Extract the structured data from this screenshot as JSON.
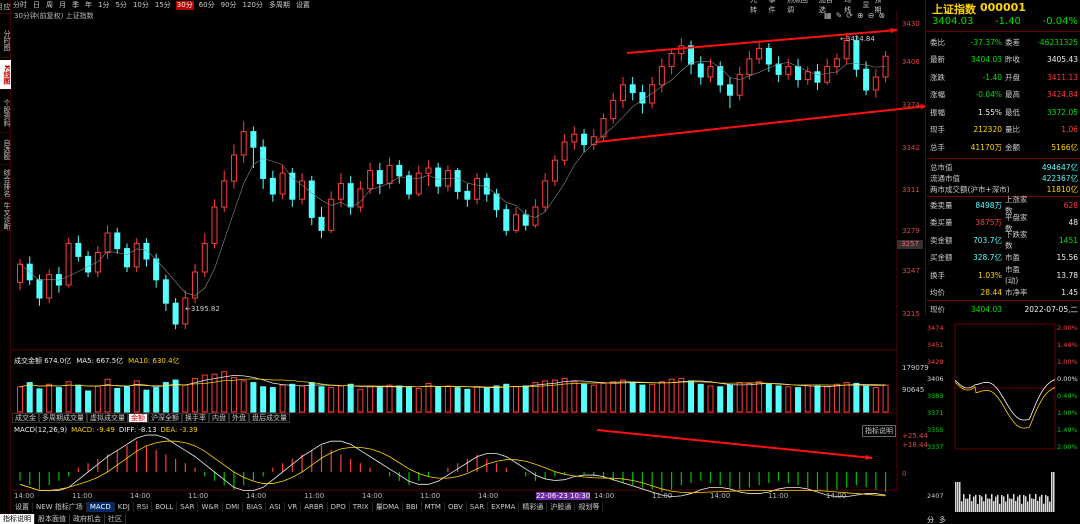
{
  "sidebar": {
    "items": [
      "应用",
      "分时图",
      "K线图",
      "个股资料",
      "自选股",
      "综合排名",
      "牛叉诊断"
    ]
  },
  "periods": [
    "分时",
    "日",
    "周",
    "月",
    "季",
    "年",
    "1分",
    "5分",
    "10分",
    "15分",
    "30分",
    "60分",
    "90分",
    "120分",
    "多周期",
    "设置"
  ],
  "active_period": "30分",
  "toolbar": [
    "九转",
    "事件",
    "热点回调",
    "加自选",
    "均线",
    "显",
    "预期"
  ],
  "chart_title": "30分钟(前复权) 上证指数",
  "price_axis": [
    "3430",
    "3406",
    "3374",
    "3342",
    "3311",
    "3279",
    "3257",
    "3247",
    "3215"
  ],
  "price_current_label": "3257",
  "annot_high": "3424.84",
  "annot_low": "3195.82",
  "volume_header": {
    "label": "成交金额 674.0亿",
    "ma5": "MA5: 667.5亿",
    "ma10": "MA10: 630.4亿"
  },
  "volume_axis": [
    "179079",
    "90645"
  ],
  "sub_tabs": [
    "成交金",
    "多周期成交量",
    "虚拟成交量",
    "金额",
    "沪深全额",
    "换手率",
    "内盘",
    "外盘",
    "盘后成交量"
  ],
  "active_sub_tab": "金额",
  "macd_header": {
    "label": "MACD(12,26,9)",
    "macd": "MACD: -9.49",
    "diff": "DIFF: -8.13",
    "dea": "DEA: -3.39"
  },
  "macd_axis": [
    "+25.44",
    "+18.44",
    "0"
  ],
  "macd_button": "指标说明",
  "time_axis": [
    "14:00",
    "11:00",
    "14:00",
    "11:00",
    "14:00",
    "11:00",
    "14:00",
    "11:00",
    "14:00",
    "22-06-23 10:30",
    "14:00",
    "11:00",
    "14:00",
    "11:00",
    "14:00"
  ],
  "bottom_tabs": [
    "设置",
    "NEW 指标广场",
    "MACD",
    "KDJ",
    "RSI",
    "BOLL",
    "SAR",
    "W&R",
    "DMI",
    "BIAS",
    "ASI",
    "VR",
    "ARBR",
    "DPO",
    "TRIX",
    "量DMA",
    "BBI",
    "MTM",
    "OBV",
    "SAR",
    "EXPMA",
    "精彩通",
    "沪股通",
    "规划等"
  ],
  "active_bottom_tab": "MACD",
  "status_tabs": [
    "指标说明",
    "股本面值",
    "政府机会",
    "社区"
  ],
  "active_status_tab": "指标说明",
  "quote": {
    "name": "上证指数",
    "code": "000001",
    "price": "3404.03",
    "change": "-1.40",
    "change_pct": "-0.04%",
    "rows": [
      {
        "l1": "委比",
        "v1": "-37.37%",
        "c1": "green",
        "l2": "委差",
        "v2": "-46231325",
        "c2": "green"
      },
      {
        "l1": "最新",
        "v1": "3404.03",
        "c1": "green",
        "l2": "昨收",
        "v2": "3405.43",
        "c2": "white"
      },
      {
        "l1": "涨跌",
        "v1": "-1.40",
        "c1": "green",
        "l2": "开盘",
        "v2": "3411.13",
        "c2": "red"
      },
      {
        "l1": "涨幅",
        "v1": "-0.04%",
        "c1": "green",
        "l2": "最高",
        "v2": "3424.84",
        "c2": "red"
      },
      {
        "l1": "振幅",
        "v1": "1.55%",
        "c1": "white",
        "l2": "最低",
        "v2": "3372.05",
        "c2": "green"
      },
      {
        "l1": "现手",
        "v1": "212320",
        "c1": "yellow",
        "l2": "量比",
        "v2": "1.06",
        "c2": "red"
      },
      {
        "l1": "总手",
        "v1": "41170万",
        "c1": "yellow",
        "l2": "金额",
        "v2": "5166亿",
        "c2": "yellow"
      }
    ],
    "cap": [
      {
        "l": "总市值",
        "v": "494647亿",
        "c": "cyan"
      },
      {
        "l": "流通市值",
        "v": "422367亿",
        "c": "cyan"
      },
      {
        "l": "两市成交额(沪市+深市)",
        "v": "11810亿",
        "c": "yellow"
      }
    ],
    "rows2": [
      {
        "l1": "委卖量",
        "v1": "8498万",
        "c1": "cyan",
        "l2": "上涨家数",
        "v2": "628",
        "c2": "red"
      },
      {
        "l1": "委买量",
        "v1": "3875万",
        "c1": "red",
        "l2": "平盘家数",
        "v2": "48",
        "c2": "white"
      },
      {
        "l1": "卖金额",
        "v1": "703.7亿",
        "c1": "cyan",
        "l2": "下跌家数",
        "v2": "1451",
        "c2": "green"
      },
      {
        "l1": "买金额",
        "v1": "328.7亿",
        "c1": "cyan",
        "l2": "市盈",
        "v2": "15.56",
        "c2": "white"
      },
      {
        "l1": "换手",
        "v1": "1.03%",
        "c1": "yellow",
        "l2": "市盈(动)",
        "v2": "13.78",
        "c2": "white"
      },
      {
        "l1": "均价",
        "v1": "28.44",
        "c1": "yellow",
        "l2": "市净率",
        "v2": "1.45",
        "c2": "white"
      }
    ],
    "now_label": "现价",
    "now_value": "3404.03",
    "date": "2022-07-05,二"
  },
  "mini_axis_left": [
    "3474",
    "3451",
    "3429",
    "3406",
    "3383",
    "3371",
    "3355",
    "3337"
  ],
  "mini_axis_right": [
    "2.00%",
    "1.49%",
    "1.00%",
    "0.00%",
    "0.49%",
    "1.00%",
    "1.49%",
    "2.00%"
  ],
  "mini_vol_axis": [
    "2407"
  ],
  "mini_bottom": [
    "分",
    "多"
  ],
  "chart_data": {
    "type": "candlestick",
    "price_range": [
      3180,
      3440
    ],
    "candles": [
      [
        3232,
        3246,
        3226,
        3250
      ],
      [
        3246,
        3234,
        3230,
        3252
      ],
      [
        3234,
        3220,
        3214,
        3238
      ],
      [
        3220,
        3238,
        3216,
        3242
      ],
      [
        3238,
        3230,
        3224,
        3244
      ],
      [
        3230,
        3262,
        3228,
        3266
      ],
      [
        3262,
        3252,
        3248,
        3268
      ],
      [
        3252,
        3240,
        3236,
        3256
      ],
      [
        3240,
        3255,
        3236,
        3260
      ],
      [
        3255,
        3270,
        3250,
        3276
      ],
      [
        3270,
        3258,
        3254,
        3274
      ],
      [
        3258,
        3244,
        3240,
        3262
      ],
      [
        3244,
        3262,
        3240,
        3266
      ],
      [
        3262,
        3250,
        3244,
        3266
      ],
      [
        3250,
        3234,
        3228,
        3254
      ],
      [
        3234,
        3216,
        3210,
        3238
      ],
      [
        3216,
        3200,
        3196,
        3220
      ],
      [
        3200,
        3220,
        3196,
        3226
      ],
      [
        3220,
        3240,
        3216,
        3246
      ],
      [
        3240,
        3262,
        3236,
        3270
      ],
      [
        3262,
        3290,
        3258,
        3296
      ],
      [
        3290,
        3310,
        3286,
        3318
      ],
      [
        3310,
        3330,
        3304,
        3338
      ],
      [
        3330,
        3348,
        3324,
        3356
      ],
      [
        3348,
        3336,
        3320,
        3352
      ],
      [
        3336,
        3312,
        3304,
        3342
      ],
      [
        3312,
        3300,
        3294,
        3318
      ],
      [
        3300,
        3316,
        3296,
        3322
      ],
      [
        3316,
        3296,
        3290,
        3320
      ],
      [
        3296,
        3310,
        3292,
        3316
      ],
      [
        3310,
        3282,
        3276,
        3314
      ],
      [
        3282,
        3272,
        3266,
        3290
      ],
      [
        3272,
        3296,
        3270,
        3302
      ],
      [
        3296,
        3308,
        3290,
        3316
      ],
      [
        3308,
        3290,
        3284,
        3314
      ],
      [
        3290,
        3304,
        3286,
        3310
      ],
      [
        3304,
        3318,
        3300,
        3324
      ],
      [
        3318,
        3308,
        3300,
        3324
      ],
      [
        3308,
        3322,
        3304,
        3328
      ],
      [
        3322,
        3314,
        3308,
        3326
      ],
      [
        3314,
        3300,
        3296,
        3318
      ],
      [
        3300,
        3316,
        3298,
        3322
      ],
      [
        3316,
        3320,
        3306,
        3326
      ],
      [
        3320,
        3306,
        3300,
        3324
      ],
      [
        3306,
        3318,
        3302,
        3322
      ],
      [
        3318,
        3302,
        3296,
        3320
      ],
      [
        3302,
        3296,
        3290,
        3308
      ],
      [
        3296,
        3312,
        3292,
        3316
      ],
      [
        3312,
        3300,
        3294,
        3316
      ],
      [
        3300,
        3288,
        3282,
        3304
      ],
      [
        3288,
        3272,
        3268,
        3292
      ],
      [
        3272,
        3284,
        3270,
        3290
      ],
      [
        3284,
        3276,
        3272,
        3288
      ],
      [
        3276,
        3290,
        3274,
        3296
      ],
      [
        3290,
        3310,
        3286,
        3316
      ],
      [
        3310,
        3326,
        3306,
        3330
      ],
      [
        3326,
        3340,
        3322,
        3346
      ],
      [
        3340,
        3346,
        3334,
        3352
      ],
      [
        3346,
        3338,
        3332,
        3350
      ],
      [
        3338,
        3344,
        3334,
        3350
      ],
      [
        3344,
        3358,
        3340,
        3362
      ],
      [
        3358,
        3372,
        3354,
        3378
      ],
      [
        3372,
        3384,
        3366,
        3390
      ],
      [
        3384,
        3378,
        3372,
        3390
      ],
      [
        3378,
        3370,
        3362,
        3384
      ],
      [
        3370,
        3384,
        3366,
        3390
      ],
      [
        3384,
        3398,
        3378,
        3404
      ],
      [
        3398,
        3408,
        3392,
        3412
      ],
      [
        3408,
        3414,
        3402,
        3420
      ],
      [
        3414,
        3400,
        3392,
        3418
      ],
      [
        3400,
        3390,
        3384,
        3406
      ],
      [
        3390,
        3398,
        3386,
        3404
      ],
      [
        3398,
        3384,
        3378,
        3402
      ],
      [
        3384,
        3376,
        3366,
        3390
      ],
      [
        3376,
        3392,
        3372,
        3398
      ],
      [
        3392,
        3404,
        3388,
        3410
      ],
      [
        3404,
        3412,
        3400,
        3418
      ],
      [
        3412,
        3400,
        3394,
        3416
      ],
      [
        3400,
        3392,
        3386,
        3406
      ],
      [
        3392,
        3398,
        3388,
        3404
      ],
      [
        3398,
        3388,
        3382,
        3404
      ],
      [
        3388,
        3394,
        3384,
        3398
      ],
      [
        3394,
        3386,
        3380,
        3400
      ],
      [
        3386,
        3398,
        3384,
        3404
      ],
      [
        3398,
        3404,
        3392,
        3408
      ],
      [
        3404,
        3418,
        3400,
        3424
      ],
      [
        3418,
        3396,
        3390,
        3422
      ],
      [
        3396,
        3380,
        3376,
        3402
      ],
      [
        3380,
        3390,
        3374,
        3396
      ],
      [
        3390,
        3406,
        3386,
        3410
      ]
    ],
    "volume": [
      60,
      70,
      55,
      66,
      58,
      72,
      64,
      50,
      62,
      78,
      56,
      60,
      74,
      52,
      58,
      70,
      76,
      64,
      80,
      88,
      90,
      96,
      82,
      74,
      70,
      60,
      58,
      64,
      66,
      62,
      70,
      60,
      58,
      62,
      66,
      54,
      60,
      58,
      64,
      62,
      60,
      56,
      68,
      60,
      62,
      58,
      54,
      60,
      56,
      62,
      66,
      60,
      62,
      70,
      74,
      76,
      80,
      72,
      66,
      64,
      68,
      72,
      76,
      70,
      64,
      66,
      72,
      78,
      80,
      74,
      66,
      62,
      60,
      64,
      70,
      68,
      72,
      66,
      62,
      60,
      58,
      64,
      62,
      60,
      66,
      70,
      68,
      62,
      58,
      64
    ],
    "macd": [
      -4,
      -6,
      -8,
      -6,
      -4,
      -2,
      2,
      4,
      6,
      8,
      10,
      12,
      14,
      12,
      10,
      8,
      6,
      4,
      2,
      -2,
      -4,
      -6,
      -8,
      -6,
      -4,
      -2,
      2,
      4,
      6,
      8,
      10,
      12,
      10,
      8,
      6,
      4,
      2,
      0,
      -2,
      -4,
      -6,
      -4,
      -2,
      0,
      2,
      4,
      6,
      8,
      6,
      4,
      2,
      0,
      -2,
      -4,
      -3,
      -2,
      -1,
      0,
      -1,
      -2,
      -3,
      -4,
      -5,
      -6,
      -7,
      -8,
      -9,
      -8,
      -6,
      -5,
      -4,
      -5,
      -6,
      -7,
      -8,
      -7,
      -6,
      -5,
      -4,
      -5,
      -6,
      -7,
      -8,
      -9,
      -8,
      -7,
      -6,
      -7,
      -8,
      -9
    ]
  },
  "colors": {
    "up": "#ff3c3c",
    "down": "#54ffff",
    "ma": "#ffd400",
    "bg": "#000000",
    "grid": "#5a0000"
  }
}
